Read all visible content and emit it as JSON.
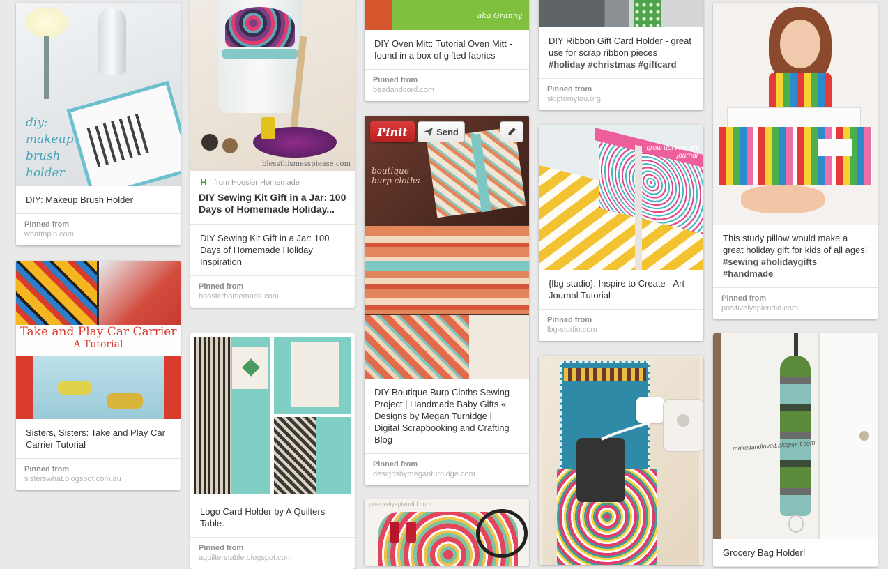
{
  "labels": {
    "pinned_from": "Pinned from",
    "pin_it": "Pinit",
    "send": "Send"
  },
  "col1": {
    "pin1": {
      "description": "DIY: Makeup Brush Holder",
      "source": "whattopin.com",
      "image_text": "diy:\nmakeup\nbrush\nholder"
    },
    "pin2": {
      "description": "Sisters, Sisters: Take and Play Car Carrier Tutorial",
      "source": "sisterswhat.blogspot.com.au",
      "image_title": "Take and Play Car Carrier",
      "image_subtitle": "A Tutorial"
    }
  },
  "col2": {
    "pin1": {
      "watermark": "blessthismessplease.com",
      "via_logo": "H",
      "via_text": "from Hoosier Homemade",
      "via_title": "DIY Sewing Kit Gift in a Jar: 100 Days of Homemade Holiday...",
      "description": "DIY Sewing Kit Gift in a Jar: 100 Days of Homemade Holiday Inspiration",
      "source": "hoosierhomemade.com"
    },
    "pin2": {
      "description": "Logo Card Holder by A Quilters Table.",
      "source": "aquilterstable.blogspot.com"
    }
  },
  "col3": {
    "pin1": {
      "description": "DIY Oven Mitt: Tutorial Oven Mitt - found in a box of gifted fabrics",
      "source": "beadandcord.com",
      "image_text": "aka Granny"
    },
    "pin2": {
      "image_text": "boutique burp cloths",
      "description": "DIY Boutique Burp Cloths Sewing Project | Handmade Baby Gifts « Designs by Megan Turnidge | Digital Scrapbooking and Crafting Blog",
      "source": "designsbymeganturnidge.com"
    },
    "pin3": {
      "image_text": "positivelysplendid.com"
    }
  },
  "col4": {
    "pin1": {
      "description": "DIY Ribbon Gift Card Holder - great use for scrap ribbon pieces",
      "tags": "#holiday #christmas #giftcard",
      "source": "skiptomylou.org"
    },
    "pin2": {
      "image_text": "grow up! kids art journal",
      "description": "{lbg studio}: Inspire to Create - Art Journal Tutorial",
      "source": "lbg-studio.com"
    }
  },
  "col5": {
    "pin1": {
      "description": "This study pillow would make a great holiday gift for kids of all ages!",
      "tags": "#sewing #holidaygifts #handmade",
      "source": "positivelysplendid.com"
    },
    "pin2": {
      "image_text": "makeitandloveit.blogspot.com",
      "description": "Grocery Bag Holder!"
    }
  },
  "colors": {
    "background": "#e9e9e9",
    "pin_red": "#cb2027"
  }
}
